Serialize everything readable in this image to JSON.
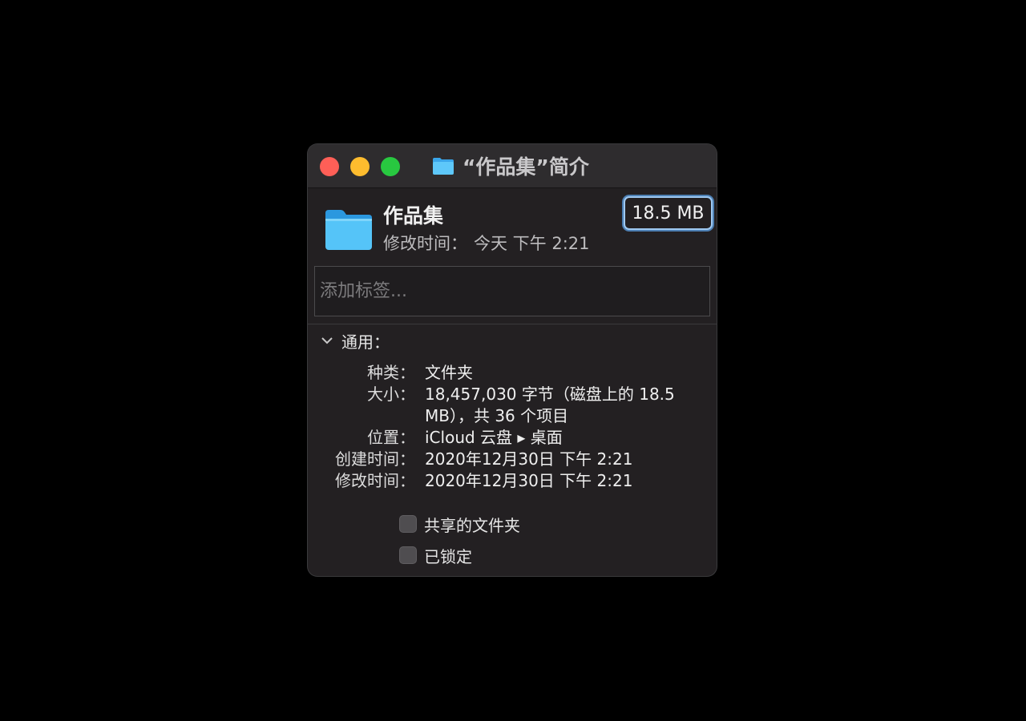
{
  "window": {
    "title": "“作品集”简介"
  },
  "file": {
    "name": "作品集",
    "modified_label": "修改时间：",
    "modified_value": "今天 下午 2:21",
    "size_badge": "18.5 MB"
  },
  "tags": {
    "placeholder": "添加标签..."
  },
  "general": {
    "title": "通用：",
    "rows": [
      {
        "label": "种类：",
        "value": "文件夹"
      },
      {
        "label": "大小：",
        "value": "18,457,030 字节（磁盘上的 18.5 MB），共 36 个项目"
      },
      {
        "label": "位置：",
        "value": "iCloud 云盘 ▸ 桌面"
      },
      {
        "label": "创建时间：",
        "value": "2020年12月30日 下午 2:21"
      },
      {
        "label": "修改时间：",
        "value": "2020年12月30日 下午 2:21"
      }
    ]
  },
  "options": {
    "shared_folder": {
      "label": "共享的文件夹",
      "checked": false
    },
    "locked": {
      "label": "已锁定",
      "checked": false
    }
  },
  "icons": {
    "folder": "folder-icon",
    "chevron": "chevron-down-icon"
  },
  "colors": {
    "folder_light": "#55c4f8",
    "folder_dark": "#2b98df",
    "focus_ring": "#9fc9f2",
    "close": "#ff5f57",
    "minimize": "#febc2e",
    "maximize": "#28c840"
  }
}
